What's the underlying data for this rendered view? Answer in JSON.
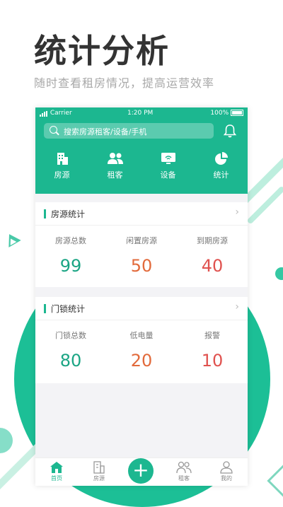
{
  "banner": {
    "headline": "统计分析",
    "subline": "随时查看租房情况，提高运营效率"
  },
  "status_bar": {
    "carrier": "Carrier",
    "time": "1:20 PM",
    "battery": "100%"
  },
  "search": {
    "placeholder": "搜索房源租客/设备/手机"
  },
  "quick_nav": [
    {
      "label": "房源",
      "icon": "building-icon"
    },
    {
      "label": "租客",
      "icon": "people-icon"
    },
    {
      "label": "设备",
      "icon": "wifi-device-icon"
    },
    {
      "label": "统计",
      "icon": "pie-chart-icon"
    }
  ],
  "housing_stats": {
    "title": "房源统计",
    "metrics": [
      {
        "label": "房源总数",
        "value": "99",
        "color": "#1ba584"
      },
      {
        "label": "闲置房源",
        "value": "50",
        "color": "#e26a3b"
      },
      {
        "label": "到期房源",
        "value": "40",
        "color": "#e0524f"
      }
    ]
  },
  "lock_stats": {
    "title": "门锁统计",
    "metrics": [
      {
        "label": "门锁总数",
        "value": "80",
        "color": "#1ba584"
      },
      {
        "label": "低电量",
        "value": "20",
        "color": "#e26a3b"
      },
      {
        "label": "报警",
        "value": "10",
        "color": "#e0524f"
      }
    ]
  },
  "tabbar": {
    "items": [
      {
        "label": "首页",
        "icon": "home-icon",
        "active": true
      },
      {
        "label": "房源",
        "icon": "building-outline-icon",
        "active": false
      },
      {
        "label": "",
        "icon": "plus-icon",
        "active": false
      },
      {
        "label": "租客",
        "icon": "people-outline-icon",
        "active": false
      },
      {
        "label": "我的",
        "icon": "person-icon",
        "active": false
      }
    ],
    "plus_symbol": "+"
  },
  "colors": {
    "brand": "#1cb790",
    "green_value": "#1ba584",
    "orange_value": "#e26a3b",
    "red_value": "#e0524f"
  }
}
